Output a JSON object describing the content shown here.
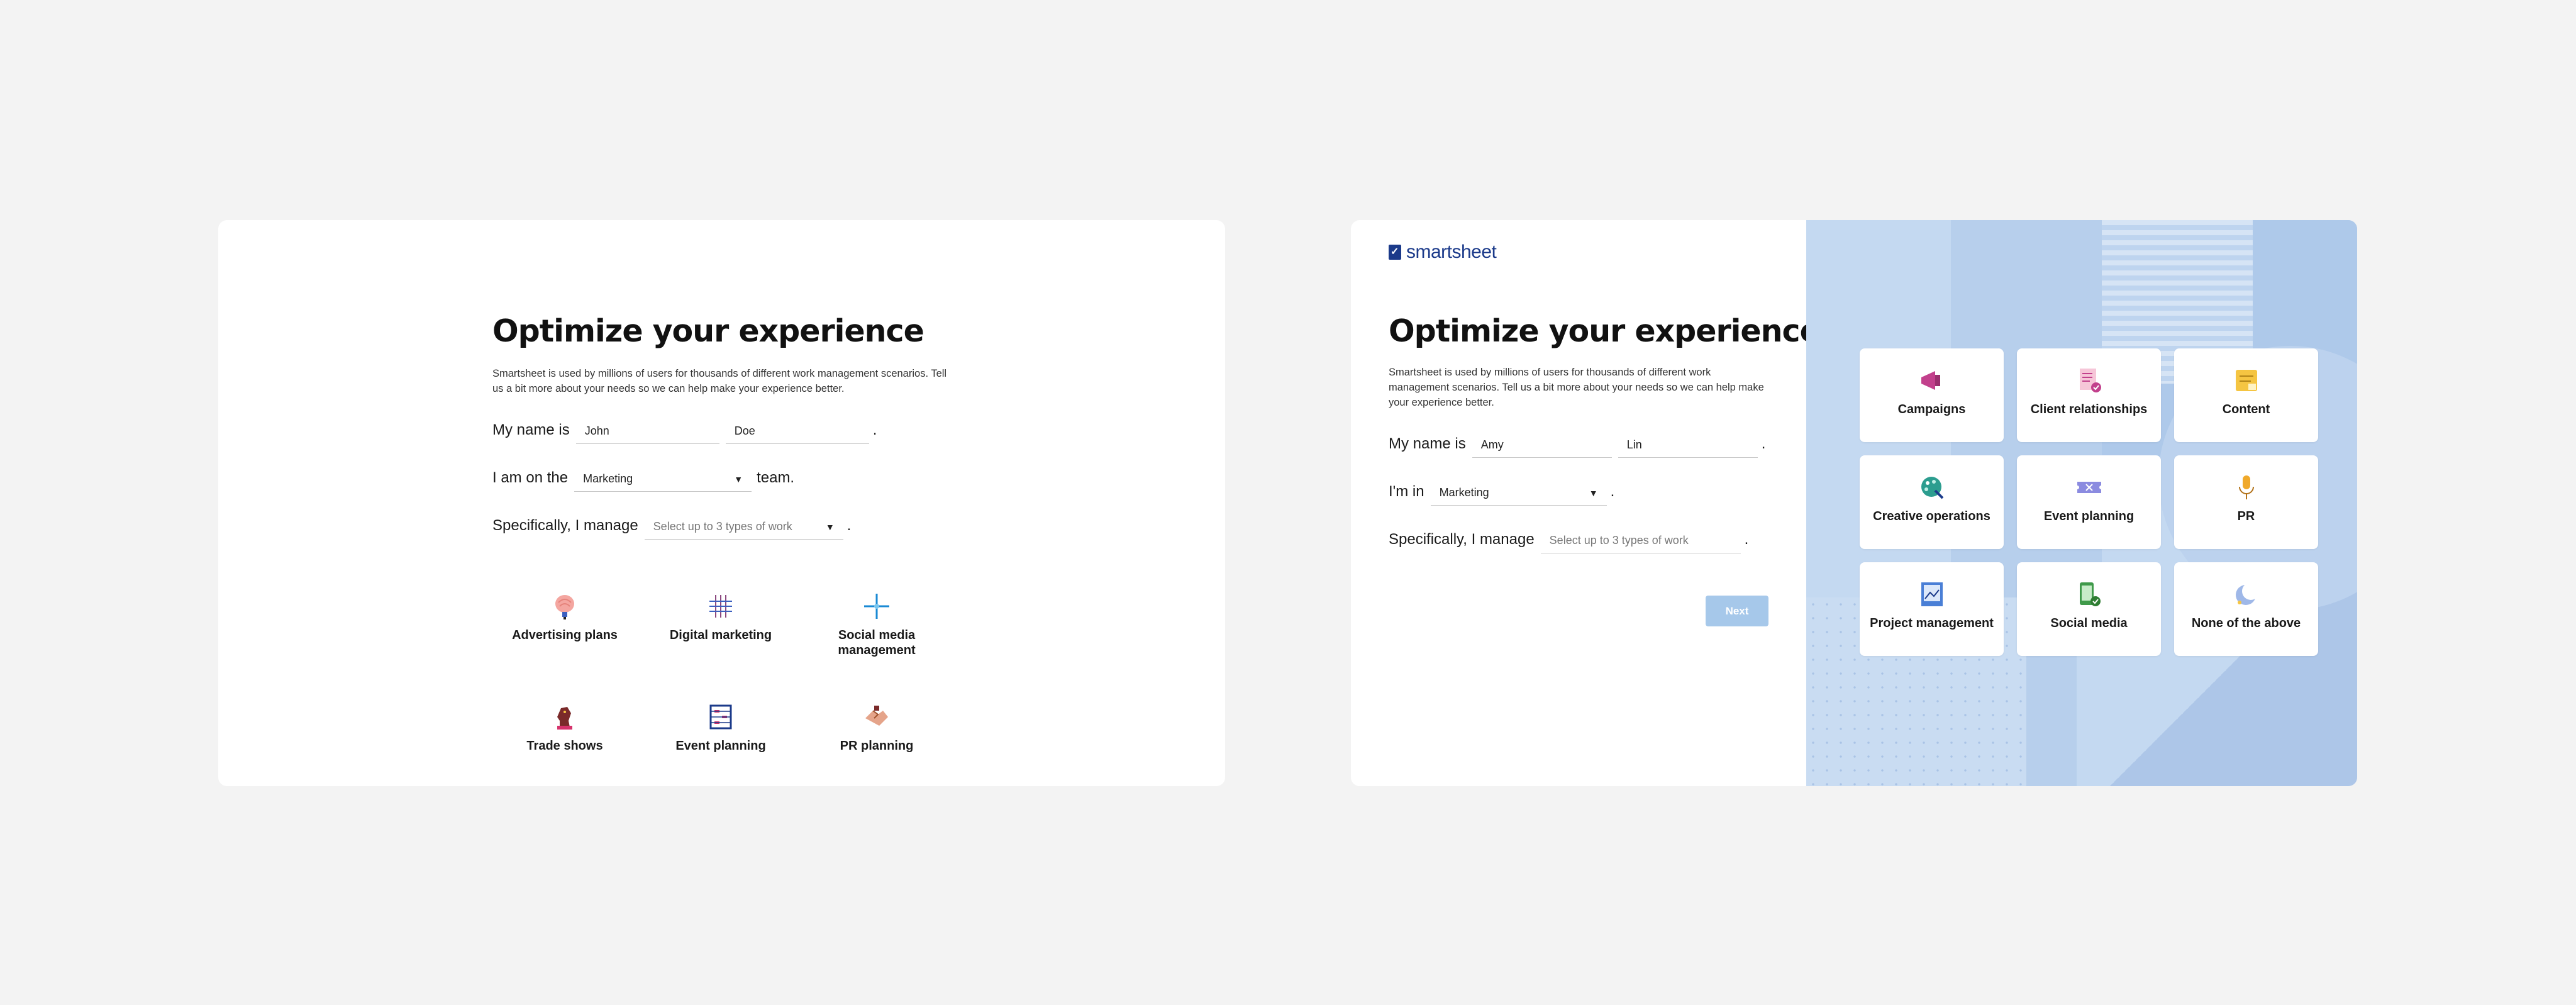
{
  "left": {
    "title": "Optimize your experience",
    "description": "Smartsheet is used by millions of users for thousands of different work management scenarios. Tell us a bit more about your needs so we can help make your experience better.",
    "name_label": "My name is",
    "first_name": "John",
    "last_name": "Doe",
    "team_prefix": "I am on the",
    "team_value": "Marketing",
    "team_suffix": "team.",
    "manage_label": "Specifically, I manage",
    "manage_placeholder": "Select up to 3 types of work",
    "period": ".",
    "options": [
      {
        "label": "Advertising plans",
        "icon": "brain-icon"
      },
      {
        "label": "Digital marketing",
        "icon": "grid-hash-icon"
      },
      {
        "label": "Social media management",
        "icon": "sparkle-icon"
      },
      {
        "label": "Trade shows",
        "icon": "chess-knight-icon"
      },
      {
        "label": "Event planning",
        "icon": "abacus-icon"
      },
      {
        "label": "PR planning",
        "icon": "handshake-icon"
      }
    ]
  },
  "right": {
    "brand": "smartsheet",
    "title": "Optimize your experience",
    "description": "Smartsheet is used by millions of users for thousands of different work management scenarios. Tell us a bit more about your needs so we can help make your experience better.",
    "name_label": "My name is",
    "first_name": "Amy",
    "last_name": "Lin",
    "team_prefix": "I'm in",
    "team_value": "Marketing",
    "manage_label": "Specifically, I manage",
    "manage_placeholder": "Select up to 3 types of work",
    "period": ".",
    "next_label": "Next",
    "cards": [
      {
        "label": "Campaigns",
        "icon": "megaphone-icon"
      },
      {
        "label": "Client relationships",
        "icon": "checklist-icon"
      },
      {
        "label": "Content",
        "icon": "notes-icon"
      },
      {
        "label": "Creative operations",
        "icon": "palette-icon"
      },
      {
        "label": "Event planning",
        "icon": "ticket-icon"
      },
      {
        "label": "PR",
        "icon": "microphone-icon"
      },
      {
        "label": "Project management",
        "icon": "board-icon"
      },
      {
        "label": "Social media",
        "icon": "phone-check-icon"
      },
      {
        "label": "None of the above",
        "icon": "moon-icon"
      }
    ]
  },
  "colors": {
    "background": "#f3f3f3",
    "brand_blue": "#1b3a8a",
    "art_blue": "#c4d9f1",
    "next_button": "#a6c8ea"
  }
}
